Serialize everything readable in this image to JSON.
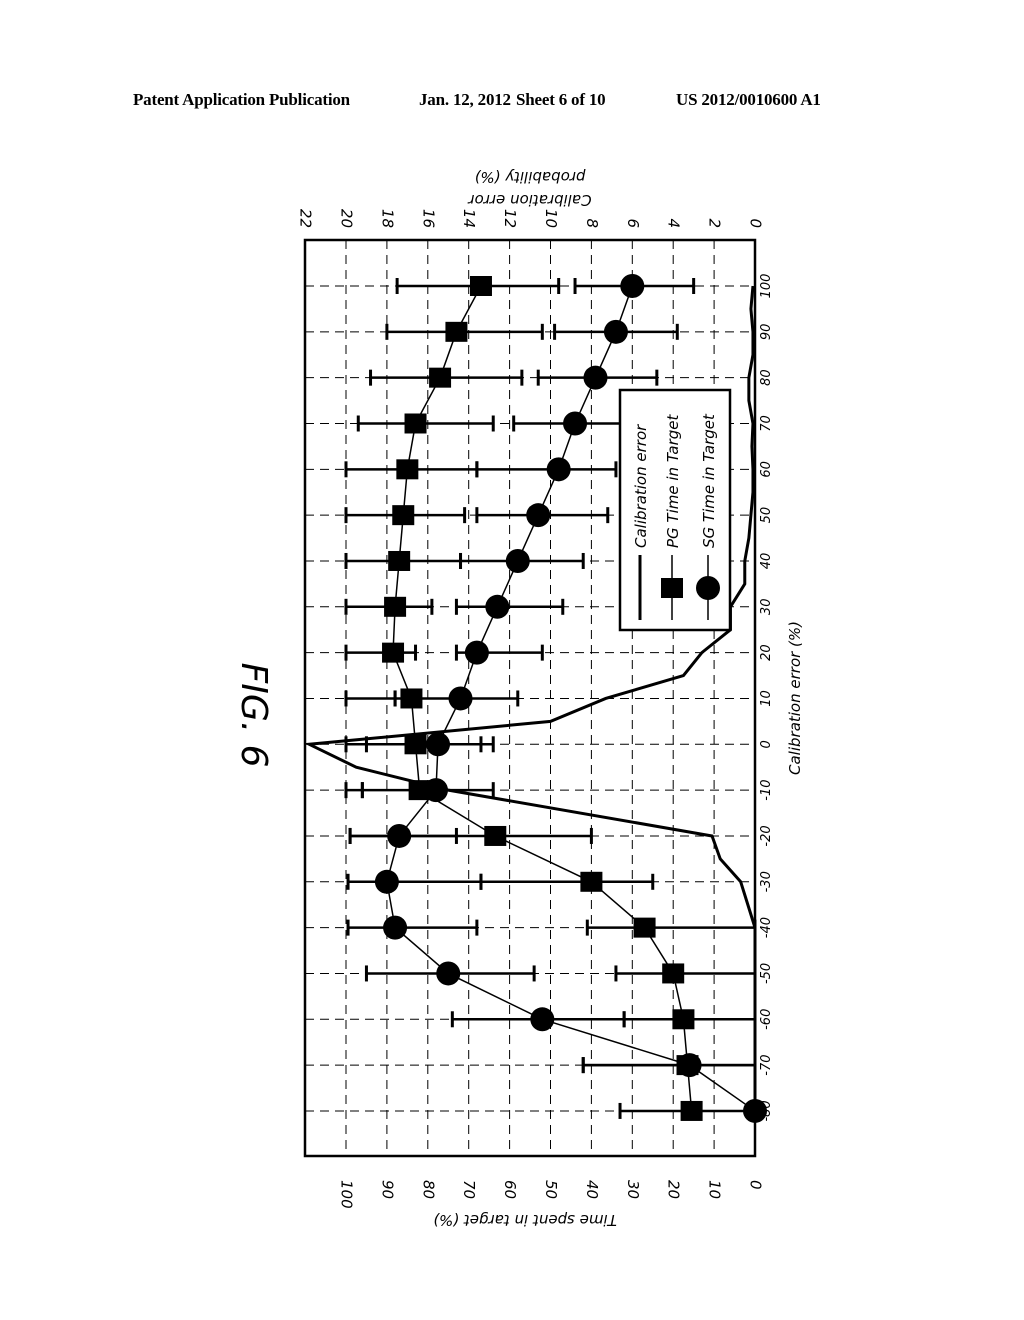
{
  "header": {
    "left": "Patent Application Publication",
    "date": "Jan. 12, 2012",
    "sheet": "Sheet 6 of 10",
    "pub_number": "US 2012/0010600 A1"
  },
  "figure_label": "FIG. 6",
  "chart_data": {
    "type": "line",
    "orientation": "rotated 90 degrees clockwise on page",
    "title": "FIG. 6",
    "xlabel": "Calibration error (%)",
    "ylabel_left": "Time spent in target (%)",
    "ylabel_right": "Calibration error probability (%)",
    "x_ticks": [
      -80,
      -70,
      -60,
      -50,
      -40,
      -30,
      -20,
      -10,
      0,
      10,
      20,
      30,
      40,
      50,
      60,
      70,
      80,
      90,
      100
    ],
    "y_left_ticks": [
      0,
      10,
      20,
      30,
      40,
      50,
      60,
      70,
      80,
      90,
      100
    ],
    "y_right_ticks": [
      0,
      2,
      4,
      6,
      8,
      10,
      12,
      14,
      16,
      18,
      20,
      22
    ],
    "xlim": [
      -90,
      100
    ],
    "y_left_lim": [
      0,
      110
    ],
    "y_right_lim": [
      0,
      22
    ],
    "grid": true,
    "legend": {
      "placement": "upper-right (in rotated frame)",
      "entries": [
        "Calibration error",
        "PG Time in Target",
        "SG Time in Target"
      ]
    },
    "series": [
      {
        "name": "Calibration error",
        "axis": "right",
        "marker": "none",
        "x": [
          -80,
          -70,
          -60,
          -50,
          -45,
          -40,
          -30,
          -25,
          -20,
          -10,
          -5,
          0,
          5,
          10,
          15,
          20,
          25,
          30,
          35,
          40,
          45,
          50,
          55,
          60,
          65,
          70,
          75,
          80,
          85,
          90,
          95,
          100
        ],
        "values": [
          0,
          0,
          0,
          0,
          0,
          0,
          0.7,
          1.7,
          2.1,
          15.0,
          19.5,
          21.8,
          10.0,
          7.3,
          3.5,
          2.6,
          1.2,
          1.2,
          0.5,
          0.5,
          0.3,
          0.2,
          0.1,
          0.1,
          0.15,
          0.1,
          0.3,
          0.3,
          0.1,
          0.1,
          0.2,
          0.1
        ]
      },
      {
        "name": "PG Time in Target",
        "axis": "left",
        "marker": "square",
        "x": [
          -80,
          -70,
          -60,
          -50,
          -40,
          -30,
          -20,
          -10,
          0,
          10,
          20,
          30,
          40,
          50,
          60,
          70,
          80,
          90,
          100
        ],
        "values": [
          15.5,
          16.5,
          17.5,
          20,
          27,
          40,
          63.5,
          82,
          83,
          84,
          88.5,
          88,
          87,
          86,
          85,
          83,
          77,
          73,
          67
        ],
        "err_low": [
          0,
          0,
          0,
          0,
          0,
          25,
          40,
          96,
          67,
          88,
          83,
          79,
          72,
          71,
          68,
          64,
          57,
          52,
          48
        ],
        "err_high": [
          33,
          42,
          32,
          34,
          41,
          67,
          99,
          100,
          100,
          100,
          100,
          100,
          100,
          100,
          100,
          97,
          94,
          90,
          87.5
        ]
      },
      {
        "name": "SG Time in Target",
        "axis": "left",
        "marker": "circle",
        "x": [
          -80,
          -70,
          -60,
          -50,
          -40,
          -30,
          -20,
          -10,
          0,
          10,
          20,
          30,
          40,
          50,
          60,
          70,
          80,
          90,
          100
        ],
        "values": [
          0,
          16,
          52,
          75,
          88,
          90,
          87,
          78,
          77.5,
          72,
          68,
          63,
          58,
          53,
          48,
          44,
          39,
          34,
          30
        ],
        "err_low": [
          0,
          0,
          32,
          54,
          68,
          67,
          73,
          64,
          64,
          58,
          52,
          47,
          42,
          36,
          34,
          24,
          24,
          19,
          15
        ],
        "err_high": [
          0,
          42,
          74,
          95,
          99.5,
          99.5,
          99,
          96,
          95,
          88,
          73,
          73,
          72,
          68,
          68,
          59,
          53,
          49,
          44
        ]
      }
    ]
  }
}
